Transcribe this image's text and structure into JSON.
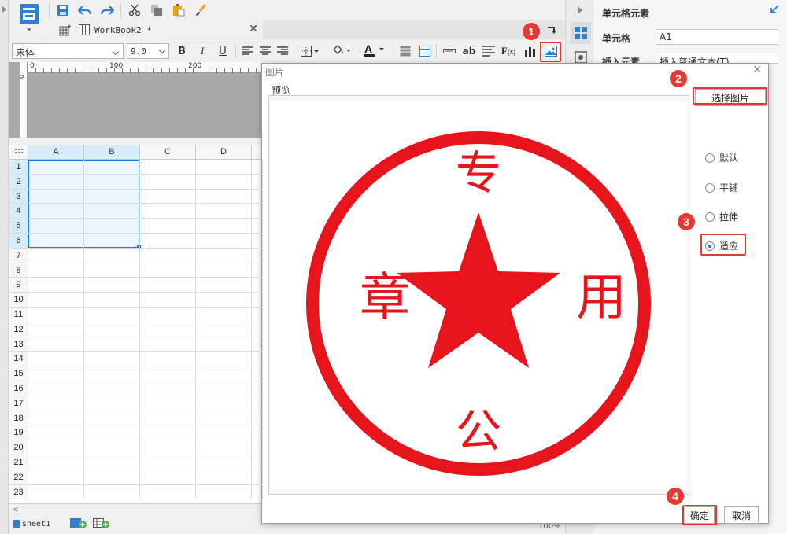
{
  "doc_tab": {
    "title": "WorkBook2 *"
  },
  "font_toolbar": {
    "font_name": "宋体",
    "font_size": "9.0"
  },
  "ruler": {
    "ticks": [
      "0",
      "100",
      "200"
    ]
  },
  "grid": {
    "columns": [
      "A",
      "B",
      "C",
      "D"
    ],
    "rows": [
      "1",
      "2",
      "3",
      "4",
      "5",
      "6",
      "7",
      "8",
      "9",
      "10",
      "11",
      "12",
      "13",
      "14",
      "15",
      "16",
      "17",
      "18",
      "19",
      "20",
      "21",
      "22",
      "23"
    ]
  },
  "sheet_tab": {
    "name": "sheet1"
  },
  "right_panel": {
    "title": "单元格元素",
    "cell_label": "单元格",
    "cell_value": "A1",
    "insert_label": "插入元素",
    "insert_value": "插入普通文本(T)"
  },
  "dialog": {
    "title": "图片",
    "preview_label": "预览",
    "choose_button": "选择图片",
    "options": [
      {
        "label": "默认",
        "checked": false
      },
      {
        "label": "平铺",
        "checked": false
      },
      {
        "label": "拉伸",
        "checked": false
      },
      {
        "label": "适应",
        "checked": true
      }
    ],
    "ok_button": "确定",
    "cancel_button": "取消",
    "stamp_chars": {
      "top": "专",
      "left": "章",
      "right": "用",
      "bottom": "公"
    }
  },
  "status": {
    "zoom": "100%"
  },
  "badges": [
    "1",
    "2",
    "3",
    "4"
  ],
  "colors": {
    "accent": "#1a73e8",
    "annotation": "#e53935",
    "stamp": "#e8141b"
  }
}
